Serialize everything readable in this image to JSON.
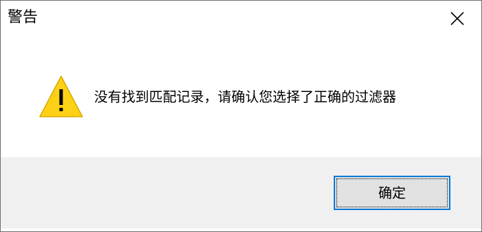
{
  "window": {
    "title": "警告",
    "close_icon": "close-icon"
  },
  "content": {
    "icon": "warning-icon",
    "icon_color": "#fcd116",
    "message": "没有找到匹配记录，请确认您选择了正确的过滤器"
  },
  "footer": {
    "ok_label": "确定",
    "button_focus_color": "#0078d7"
  }
}
